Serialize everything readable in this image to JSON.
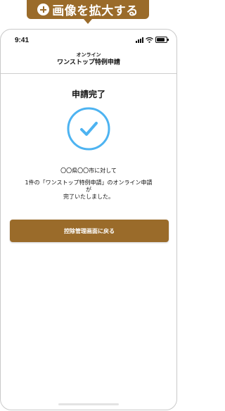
{
  "zoom_badge": {
    "label": "画像を拡大する",
    "icon": "plus-circle-icon",
    "color": "#9a6b2a"
  },
  "status_bar": {
    "time": "9:41",
    "icons": [
      "signal-icon",
      "wifi-icon",
      "battery-icon"
    ]
  },
  "header": {
    "small_title": "オンライン",
    "title": "ワンストップ特例申請"
  },
  "main": {
    "page_title": "申請完了",
    "check_icon": "check-circle-icon",
    "check_color": "#4db3f1",
    "message_line1": "〇〇県〇〇市に対して",
    "message_line2": "1件の「ワンストップ特例申請」のオンライン申請",
    "message_line3": "が",
    "message_line4": "完了いたしました。"
  },
  "action": {
    "label": "控除管理画面に戻る",
    "color": "#9a6b2a"
  }
}
